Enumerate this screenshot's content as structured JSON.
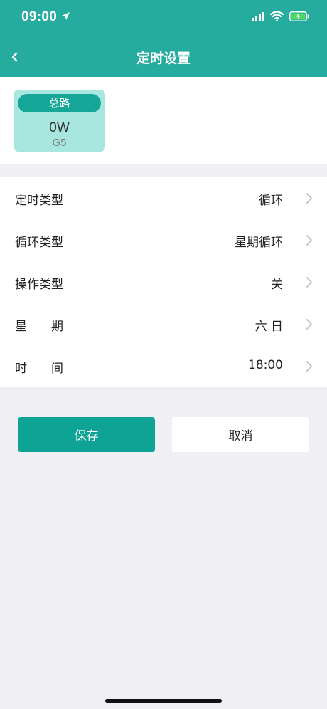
{
  "status_bar": {
    "time": "09:00",
    "icons": [
      "location-arrow-icon",
      "cellular-signal-icon",
      "wifi-icon",
      "battery-charging-icon"
    ]
  },
  "nav": {
    "title": "定时设置",
    "back_icon": "chevron-left-icon"
  },
  "device": {
    "name": "总路",
    "power": "0W",
    "code": "G5"
  },
  "settings": [
    {
      "label": "定时类型",
      "value": "循环"
    },
    {
      "label": "循环类型",
      "value": "星期循环"
    },
    {
      "label": "操作类型",
      "value": "关"
    },
    {
      "label": "星　　期",
      "value": "六 日"
    },
    {
      "label": "时　　间",
      "value": "18:00"
    }
  ],
  "actions": {
    "save_label": "保存",
    "cancel_label": "取消"
  },
  "colors": {
    "brand": "#26ab9f",
    "button_primary": "#0fa396",
    "card_bg": "#a8e7e0",
    "page_bg": "#efeff4"
  }
}
